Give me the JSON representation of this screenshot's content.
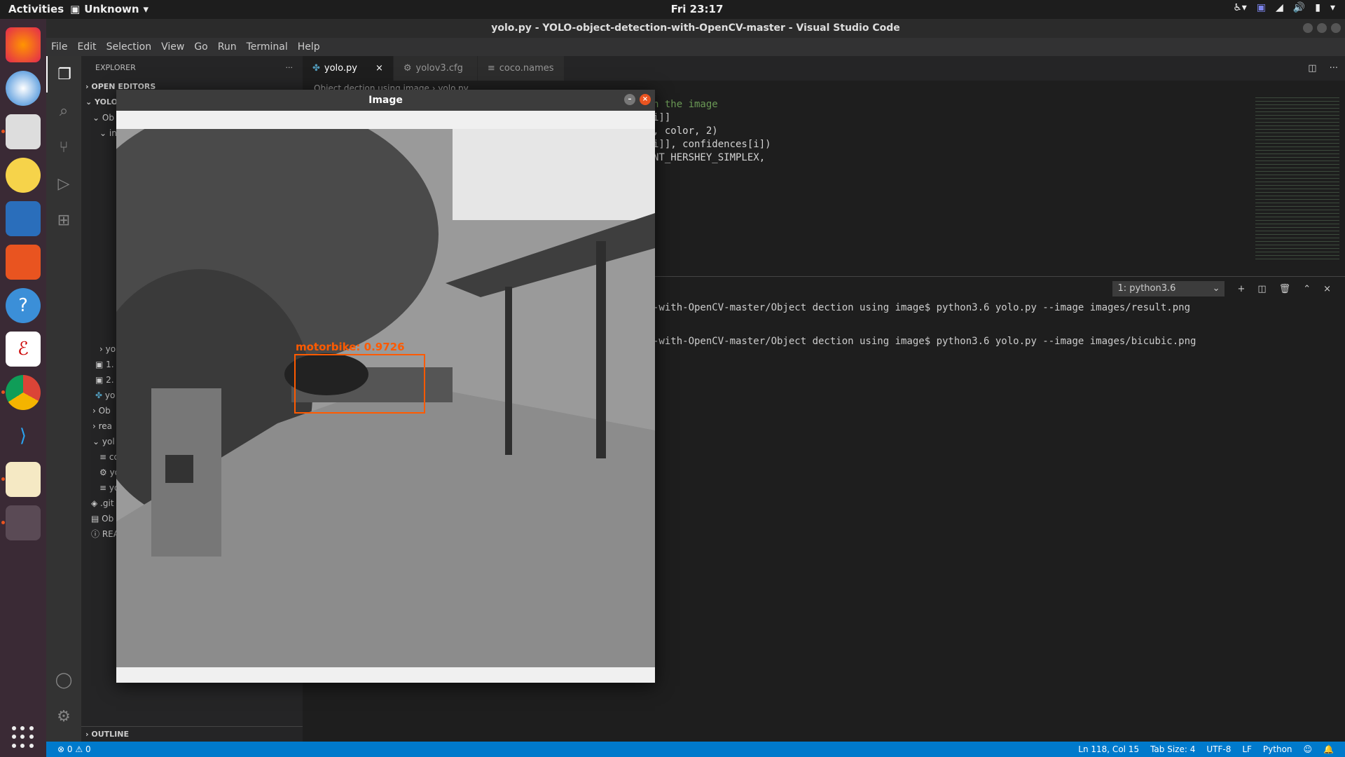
{
  "topbar": {
    "activities": "Activities",
    "app_name": "Unknown",
    "clock": "Fri 23:17"
  },
  "window": {
    "title": "yolo.py - YOLO-object-detection-with-OpenCV-master - Visual Studio Code"
  },
  "menu": [
    "File",
    "Edit",
    "Selection",
    "View",
    "Go",
    "Run",
    "Terminal",
    "Help"
  ],
  "explorer": {
    "header": "EXPLORER",
    "open_editors": "OPEN EDITORS",
    "root": "YOLO-",
    "items": [
      "Ob",
      "in",
      "yo",
      "1.",
      "2.",
      "yo",
      "Ob",
      "rea",
      "yol",
      "co",
      "yo",
      "yo",
      ".git",
      "Ob",
      "REA"
    ],
    "outline": "OUTLINE"
  },
  "tabs": [
    {
      "label": "yolo.py",
      "icon": "python-icon",
      "active": true
    },
    {
      "label": "yolov3.cfg",
      "icon": "gear-icon",
      "active": false
    },
    {
      "label": "coco.names",
      "icon": "list-icon",
      "active": false
    }
  ],
  "breadcrumb": "Object dection using image  ›  yolo.py",
  "code_lines": [
    {
      "text": "n the image",
      "class": "cm"
    },
    {
      "text": "i]]",
      "class": ""
    },
    {
      "text": ", color, 2)",
      "class": ""
    },
    {
      "text": "i]], confidences[i])",
      "class": ""
    },
    {
      "text": "NT_HERSHEY_SIMPLEX,",
      "class": ""
    }
  ],
  "terminal": {
    "selector": "1: python3.6",
    "lines": [
      "-with-OpenCV-master/Object dection using image$ python3.6 yolo.py --image images/result.png",
      "-with-OpenCV-master/Object dection using image$ python3.6 yolo.py --image images/bicubic.png"
    ]
  },
  "status": {
    "errors": "0",
    "warnings": "0",
    "position": "Ln 118, Col 15",
    "tab_size": "Tab Size: 4",
    "encoding": "UTF-8",
    "eol": "LF",
    "language": "Python"
  },
  "image_window": {
    "title": "Image",
    "detection_label": "motorbike: 0.9726",
    "box_color": "#ff5a00"
  },
  "colors": {
    "accent": "#007acc",
    "dock": "#3a2a35"
  }
}
